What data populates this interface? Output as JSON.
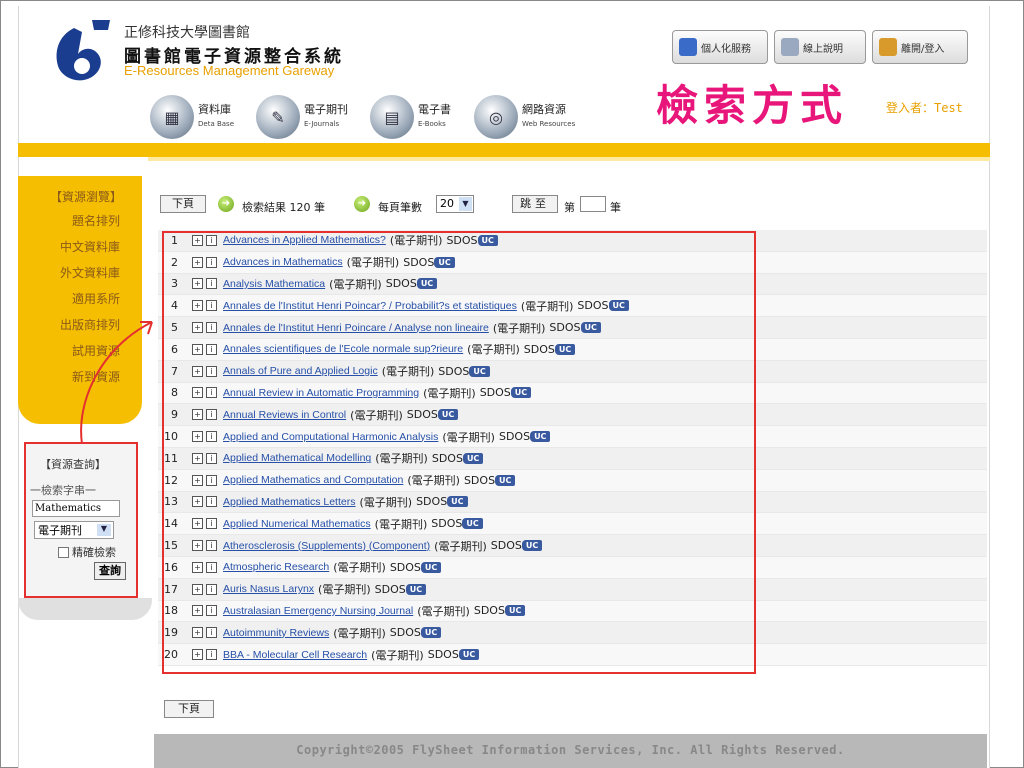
{
  "header": {
    "subtitle": "正修科技大學圖書館",
    "title": "圖書館電子資源整合系統",
    "title_en": "E-Resources Management Gareway",
    "top_buttons": [
      {
        "label": "個人化服務",
        "icon": "person-icon"
      },
      {
        "label": "線上說明",
        "icon": "help-book-icon"
      },
      {
        "label": "離開/登入",
        "icon": "exit-icon"
      }
    ],
    "categories": [
      {
        "label": "資料庫",
        "sub": "Deta Base",
        "icon": "database-icon"
      },
      {
        "label": "電子期刊",
        "sub": "E-Journals",
        "icon": "ejournal-icon"
      },
      {
        "label": "電子書",
        "sub": "E-Books",
        "icon": "ebook-icon"
      },
      {
        "label": "網路資源",
        "sub": "Web Resources",
        "icon": "web-icon"
      }
    ],
    "login_text": "登入者：Test"
  },
  "annotation": {
    "title": "檢索方式",
    "color": "#e8157a"
  },
  "sidebar": {
    "menu": [
      "【資源瀏覽】",
      "題名排列",
      "中文資料庫",
      "外文資料庫",
      "適用系所",
      "出版商排列",
      "試用資源",
      "新到資源"
    ],
    "search": {
      "heading": "【資源查詢】",
      "label": "一檢索字串一",
      "keyword": "Mathematics",
      "type_selected": "電子期刊",
      "exact_label": "精確檢索",
      "submit": "查詢"
    }
  },
  "toolbar": {
    "next_page": "下頁",
    "result_text": "檢索結果 120 筆",
    "per_page_label": "每頁筆數",
    "per_page_value": "20",
    "jump_button": "跳至",
    "jump_prefix": "第",
    "jump_suffix": "筆",
    "bottom_next": "下頁"
  },
  "results": [
    {
      "n": "1",
      "title": "Advances in Applied Mathematics?"
    },
    {
      "n": "2",
      "title": "Advances in Mathematics"
    },
    {
      "n": "3",
      "title": "Analysis Mathematica"
    },
    {
      "n": "4",
      "title": "Annales de l'Institut Henri Poincar? / Probabilit?s et statistiques"
    },
    {
      "n": "5",
      "title": "Annales de l'Institut Henri Poincare / Analyse non lineaire"
    },
    {
      "n": "6",
      "title": "Annales scientifiques de l'Ecole normale sup?rieure"
    },
    {
      "n": "7",
      "title": "Annals of Pure and Applied Logic"
    },
    {
      "n": "8",
      "title": "Annual Review in Automatic Programming"
    },
    {
      "n": "9",
      "title": "Annual Reviews in Control"
    },
    {
      "n": "10",
      "title": "Applied and Computational Harmonic Analysis"
    },
    {
      "n": "11",
      "title": "Applied Mathematical Modelling"
    },
    {
      "n": "12",
      "title": "Applied Mathematics and Computation"
    },
    {
      "n": "13",
      "title": "Applied Mathematics Letters"
    },
    {
      "n": "14",
      "title": "Applied Numerical Mathematics"
    },
    {
      "n": "15",
      "title": "Atherosclerosis (Supplements) (Component)"
    },
    {
      "n": "16",
      "title": "Atmospheric Research"
    },
    {
      "n": "17",
      "title": "Auris Nasus Larynx"
    },
    {
      "n": "18",
      "title": "Australasian Emergency Nursing Journal"
    },
    {
      "n": "19",
      "title": "Autoimmunity Reviews"
    },
    {
      "n": "20",
      "title": "BBA - Molecular Cell Research"
    }
  ],
  "result_type": "(電子期刊)",
  "result_source": "SDOS",
  "result_badge": "UC",
  "expand_glyph": "+",
  "info_glyph": "i",
  "footer": "Copyright©2005 FlySheet Information Services, Inc. All Rights Reserved."
}
